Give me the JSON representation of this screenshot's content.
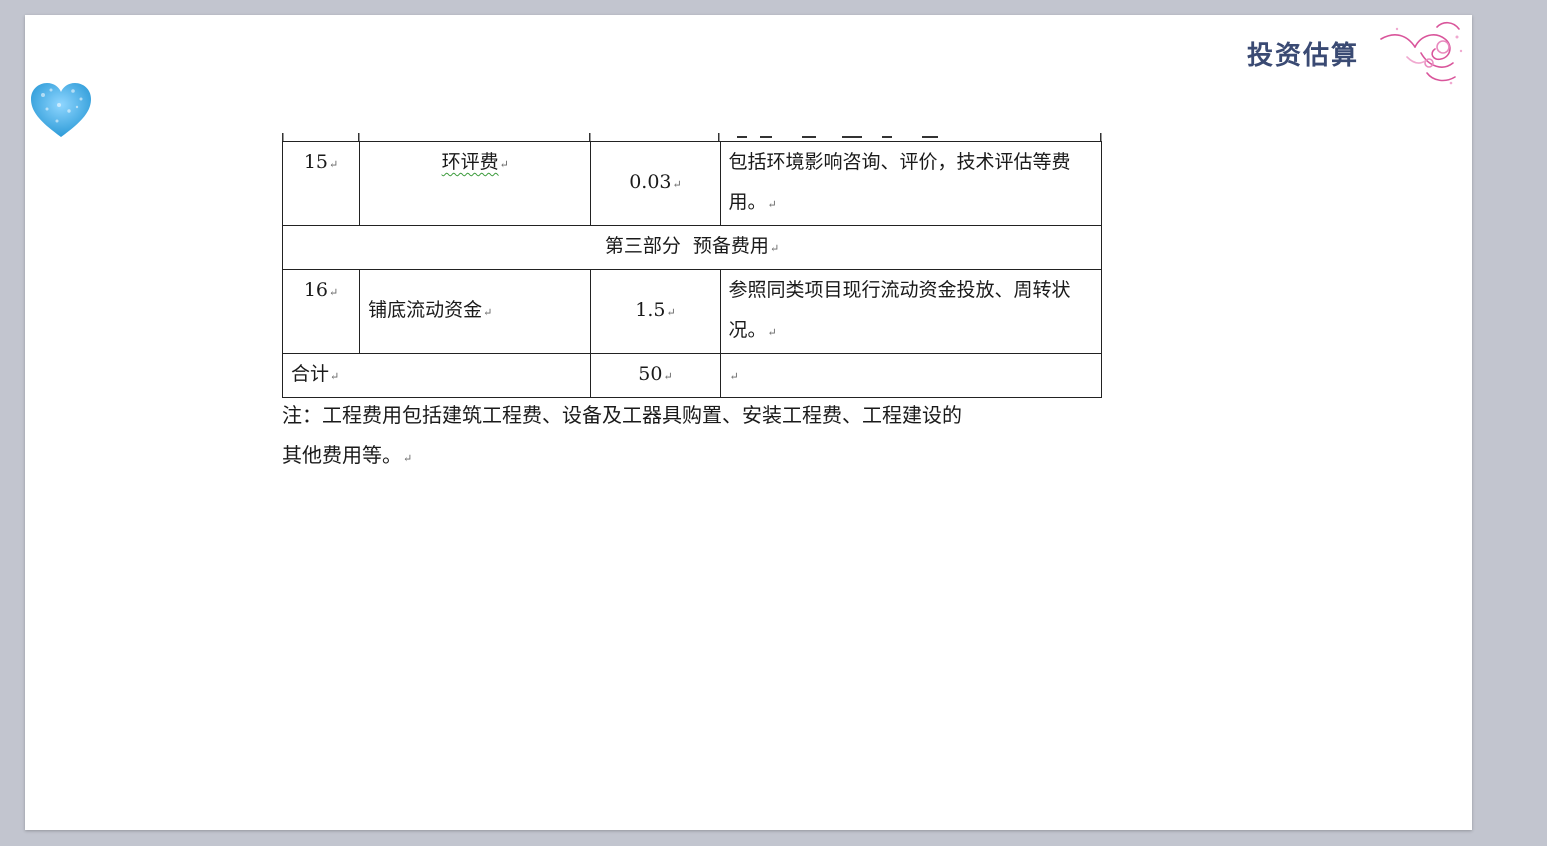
{
  "header": {
    "title": "投资估算"
  },
  "paragraph_mark": "↵",
  "table": {
    "rows": [
      {
        "no": "15",
        "name": "环评费",
        "amount": "0.03",
        "desc": "包括环境影响咨询、评价，技术评估等费用。"
      },
      {
        "section": "第三部分  预备费用"
      },
      {
        "no": "16",
        "name": "铺底流动资金",
        "amount": "1.5",
        "desc": "参照同类项目现行流动资金投放、周转状况。"
      },
      {
        "total_label": "合计",
        "total_amount": "50",
        "total_desc": ""
      }
    ]
  },
  "note": {
    "line1": "注：工程费用包括建筑工程费、设备及工器具购置、安装工程费、工程建设的",
    "line2": "其他费用等。"
  },
  "colors": {
    "background": "#c2c5cf",
    "title": "#3a4a73",
    "heart": "#3fa9e0",
    "swirl": "#d9559b"
  }
}
